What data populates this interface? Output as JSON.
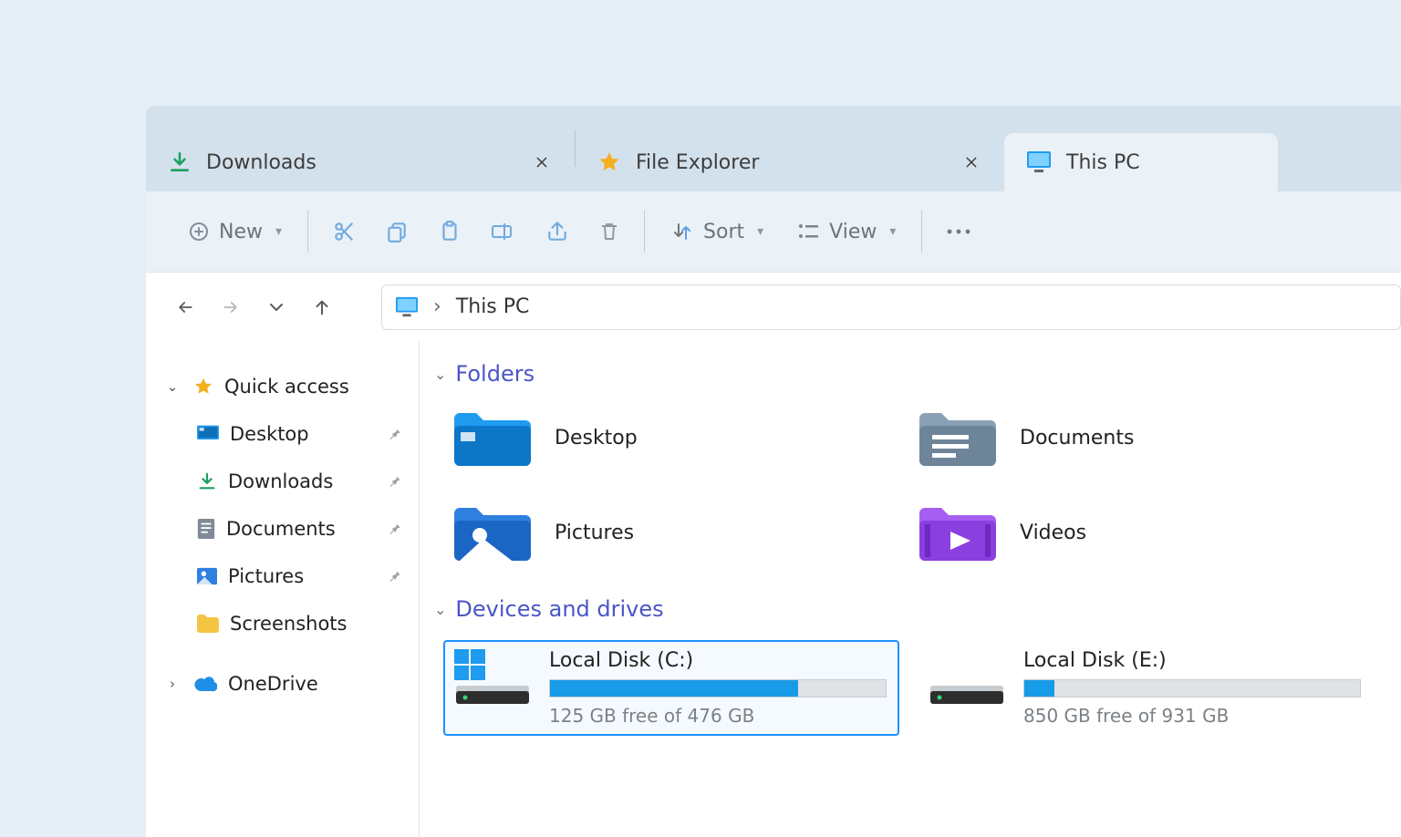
{
  "tabs": [
    {
      "label": "Downloads",
      "icon": "download"
    },
    {
      "label": "File Explorer",
      "icon": "star"
    },
    {
      "label": "This PC",
      "icon": "monitor",
      "active": true
    }
  ],
  "toolbar": {
    "new_label": "New",
    "sort_label": "Sort",
    "view_label": "View"
  },
  "breadcrumb": {
    "location": "This PC"
  },
  "sidebar": {
    "root_label": "Quick access",
    "items": [
      {
        "label": "Desktop",
        "icon": "desktop",
        "pinned": true
      },
      {
        "label": "Downloads",
        "icon": "download",
        "pinned": true
      },
      {
        "label": "Documents",
        "icon": "documents",
        "pinned": true
      },
      {
        "label": "Pictures",
        "icon": "pictures",
        "pinned": true
      },
      {
        "label": "Screenshots",
        "icon": "folder",
        "pinned": false
      }
    ],
    "onedrive_label": "OneDrive"
  },
  "sections": {
    "folders_label": "Folders",
    "drives_label": "Devices and drives"
  },
  "folders": [
    {
      "label": "Desktop",
      "icon": "desktop-folder"
    },
    {
      "label": "Documents",
      "icon": "documents-folder"
    },
    {
      "label": "Pictures",
      "icon": "pictures-folder"
    },
    {
      "label": "Videos",
      "icon": "videos-folder"
    }
  ],
  "drives": [
    {
      "name": "Local Disk (C:)",
      "free_text": "125 GB free of 476 GB",
      "used_pct": 74,
      "os": true,
      "selected": true
    },
    {
      "name": "Local Disk (E:)",
      "free_text": "850 GB free of 931 GB",
      "used_pct": 9,
      "os": false,
      "selected": false
    }
  ]
}
